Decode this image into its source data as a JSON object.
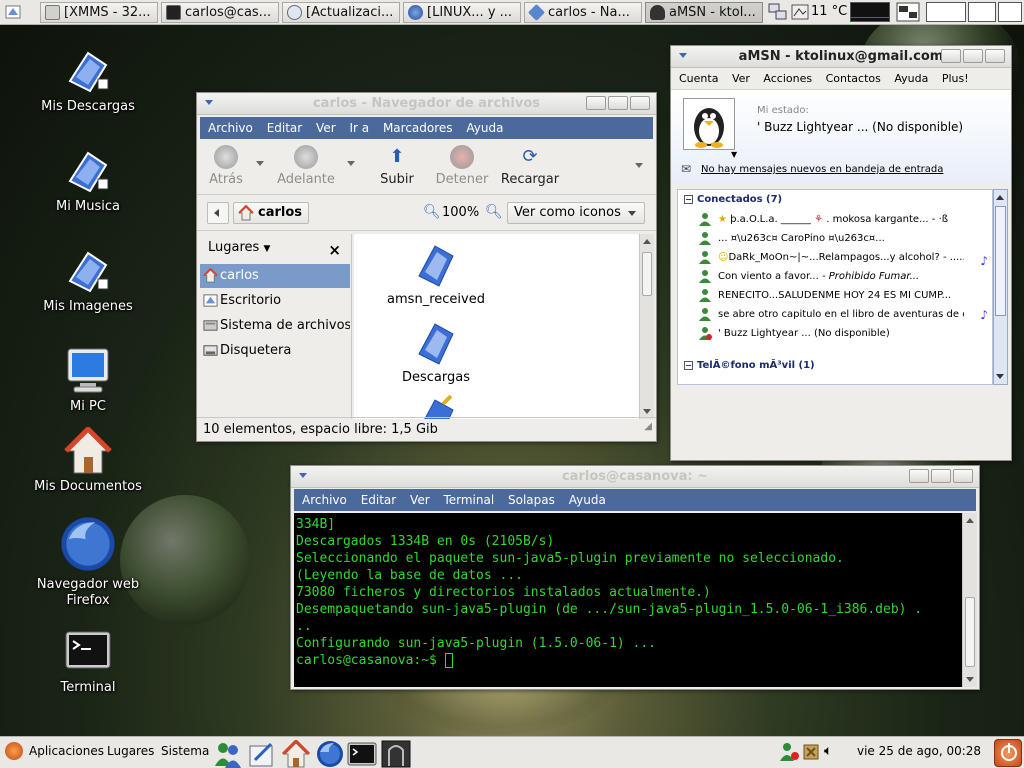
{
  "top_panel": {
    "tasks": [
      {
        "label": "[XMMS - 32...",
        "icon": "xmms-icon"
      },
      {
        "label": "carlos@cas...",
        "icon": "terminal-icon"
      },
      {
        "label": "[Actualizaci...",
        "icon": "update-icon"
      },
      {
        "label": "[LINUX... y ...",
        "icon": "firefox-icon"
      },
      {
        "label": "carlos - Na...",
        "icon": "file-browser-icon"
      },
      {
        "label": "aMSN - ktol...",
        "icon": "amsn-icon"
      }
    ],
    "weather": "11 °C"
  },
  "desktop_icons": [
    {
      "label": "Mis Descargas",
      "icon": "folder-link-icon"
    },
    {
      "label": "Mi Musica",
      "icon": "folder-link-icon"
    },
    {
      "label": "Mis Imagenes",
      "icon": "folder-link-icon"
    },
    {
      "label": "Mi PC",
      "icon": "computer-icon"
    },
    {
      "label": "Mis Documentos",
      "icon": "home-icon"
    },
    {
      "label": "Navegador web Firefox",
      "icon": "firefox-icon"
    },
    {
      "label": "Terminal",
      "icon": "terminal-icon"
    }
  ],
  "file_browser": {
    "title": "carlos - Navegador de archivos",
    "menu": [
      "Archivo",
      "Editar",
      "Ver",
      "Ir a",
      "Marcadores",
      "Ayuda"
    ],
    "toolbar": {
      "back": "Atrás",
      "forward": "Adelante",
      "up": "Subir",
      "stop": "Detener",
      "reload": "Recargar"
    },
    "location": "carlos",
    "zoom": "100%",
    "view_mode": "Ver como iconos",
    "sidebar_title": "Lugares",
    "places": [
      "carlos",
      "Escritorio",
      "Sistema de archivos",
      "Disquetera"
    ],
    "files": [
      "amsn_received",
      "Descargas"
    ],
    "status": "10 elementos, espacio libre: 1,5 Gib"
  },
  "amsn": {
    "title": "aMSN - ktolinux@gmail.com",
    "menu": [
      "Cuenta",
      "Ver",
      "Acciones",
      "Contactos",
      "Ayuda",
      "Plus!"
    ],
    "my_state_label": "Mi estado:",
    "my_state": "' Buzz Lightyear ...  (No disponible)",
    "mail_notice": "No hay mensajes nuevos en bandeja de entrada",
    "group_online": "Conectados (7)",
    "contacts": [
      {
        "name": "þ.a.O.L.a. ______",
        "extra": ". mokosa kargante... - ·ß"
      },
      {
        "name": "... ¤\\u263c¤ CaroPino ¤\\u263c¤...",
        "extra": ""
      },
      {
        "name": "DaRk_MoOn~|~...Relampagos...y alcohol?",
        "extra": "- ............"
      },
      {
        "name": "Con viento a favor...",
        "extra": "- Prohibido Fumar..."
      },
      {
        "name": "RENECITO...SALUDENME HOY 24 ES MI CUMP...",
        "extra": ""
      },
      {
        "name": "se abre otro capitulo en el libro de aventuras de corn...",
        "extra": "-"
      },
      {
        "name": "' Buzz Lightyear ...  (No disponible)",
        "extra": ""
      }
    ],
    "group_mobile": "TelÃ©fono mÃ³vil (1)"
  },
  "terminal": {
    "title": "carlos@casanova: ~",
    "menu": [
      "Archivo",
      "Editar",
      "Ver",
      "Terminal",
      "Solapas",
      "Ayuda"
    ],
    "lines": [
      "334B]",
      "Descargados 1334B en 0s (2105B/s)",
      "Seleccionando el paquete sun-java5-plugin previamente no seleccionado.",
      "(Leyendo la base de datos ...",
      "73080 ficheros y directorios instalados actualmente.)",
      "Desempaquetando sun-java5-plugin (de .../sun-java5-plugin_1.5.0-06-1_i386.deb) .",
      "..",
      "Configurando sun-java5-plugin (1.5.0-06-1) ...",
      "",
      "carlos@casanova:~$ "
    ]
  },
  "bottom_panel": {
    "menus": [
      "Aplicaciones",
      "Lugares",
      "Sistema"
    ],
    "clock": "vie 25 de ago, 00:28"
  },
  "colors": {
    "terminal_bg": "#000000",
    "terminal_fg": "#33d633",
    "menubar_blue": "#4b6a9b",
    "selection": "#7a9bc9"
  }
}
